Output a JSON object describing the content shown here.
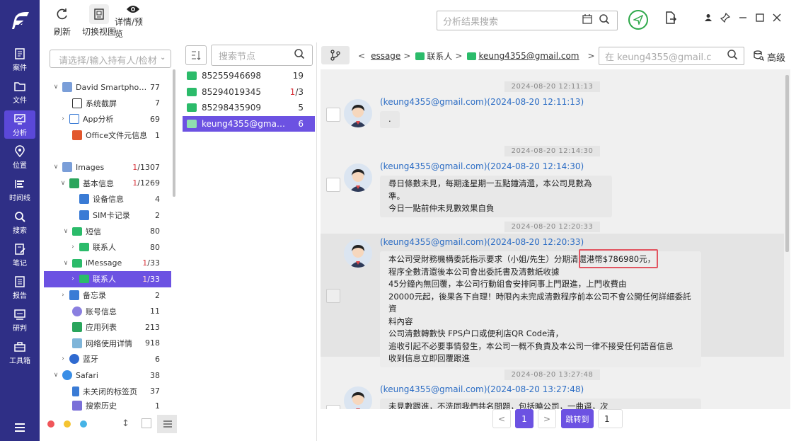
{
  "toolbar": {
    "refresh_label": "刷新",
    "switch_view_label": "切换视图",
    "detail_preview_label": "详情/预览",
    "search_placeholder": "分析结果搜索"
  },
  "nav": {
    "items": [
      {
        "label": "案件",
        "icon": "case-icon"
      },
      {
        "label": "文件",
        "icon": "folder-icon"
      },
      {
        "label": "分析",
        "icon": "analysis-icon",
        "active": true
      },
      {
        "label": "位置",
        "icon": "location-icon"
      },
      {
        "label": "时间线",
        "icon": "timeline-icon"
      },
      {
        "label": "搜索",
        "icon": "search-icon"
      },
      {
        "label": "笔记",
        "icon": "note-icon"
      },
      {
        "label": "报告",
        "icon": "report-icon"
      },
      {
        "label": "研判",
        "icon": "judge-icon"
      },
      {
        "label": "工具箱",
        "icon": "toolbox-icon"
      }
    ]
  },
  "tree": {
    "select_placeholder": "请选择/输入持有人/检材",
    "rows": [
      {
        "label": "David Smartphon...",
        "count": "77"
      },
      {
        "label": "系统截屏",
        "count": "7"
      },
      {
        "label": "App分析",
        "count": "69"
      },
      {
        "label": "Office文件元信息",
        "count": "1"
      },
      {
        "label": "Images",
        "count_red": "1",
        "count": "/1307"
      },
      {
        "label": "基本信息",
        "count_red": "1",
        "count": "/1269"
      },
      {
        "label": "设备信息",
        "count": "4"
      },
      {
        "label": "SIM卡记录",
        "count": "2"
      },
      {
        "label": "短信",
        "count": "80"
      },
      {
        "label": "联系人",
        "count": "80"
      },
      {
        "label": "iMessage",
        "count_red": "1",
        "count": "/33"
      },
      {
        "label": "联系人",
        "count_red": "1",
        "count": "/33"
      },
      {
        "label": "备忘录",
        "count": "2"
      },
      {
        "label": "账号信息",
        "count": "11"
      },
      {
        "label": "应用列表",
        "count": "213"
      },
      {
        "label": "网络使用详情",
        "count": "918"
      },
      {
        "label": "蓝牙",
        "count": "6"
      },
      {
        "label": "Safari",
        "count": "38"
      },
      {
        "label": "未关闭的标签页",
        "count": "37"
      },
      {
        "label": "搜索历史",
        "count": "1"
      }
    ]
  },
  "contacts": {
    "search_placeholder": "搜索节点",
    "items": [
      {
        "label": "85255946698",
        "count": "19"
      },
      {
        "label": "85294019345",
        "count_red": "1",
        "count": "/3"
      },
      {
        "label": "85298435909",
        "count": "5"
      },
      {
        "label": "keung4355@gmail.c...",
        "count": "6"
      }
    ]
  },
  "breadcrumb": {
    "part1": "essage",
    "part2": "联系人",
    "part3": "keung4355@gmail.com"
  },
  "msg_search_placeholder": "在 keung4355@gmail.c",
  "advanced_label": "高级",
  "messages": [
    {
      "time": "2024-08-20 12:11:13",
      "sender": "(keung4355@gmail.com)(2024-08-20 12:11:13)",
      "lines": [
        "."
      ]
    },
    {
      "time": "2024-08-20 12:14:30",
      "sender": "(keung4355@gmail.com)(2024-08-20 12:14:30)",
      "lines": [
        "尋日條數未見，每期逢星期一五點鐘清還，本公司見數為準。",
        "今日一點前仲未見數效果自負"
      ]
    },
    {
      "time": "2024-08-20 12:20:33",
      "sender": "(keung4355@gmail.com)(2024-08-20 12:20:33)",
      "lines": [
        "本公司受財務機構委託指示要求（小姐/先生）分期清還港幣$786980元，",
        "程序全數清還後本公司會出委託書及清數紙收據",
        "45分鐘內無回覆，本公司行動組會安排同事上門跟進，上門收費由",
        "20000元起，後果各下自理！時限內未完成清數程序前本公司不會公開任何詳細委託資",
        "料內容",
        "公司清數轉數快 FPS户口或便利店QR Code清，",
        "追收引起不必要事情發生，本公司一概不負責及本公司一律不接受任何語音信息",
        "收到信息立即回覆跟進"
      ]
    },
    {
      "time": "2024-08-20 13:27:48",
      "sender": "(keung4355@gmail.com)(2024-08-20 13:27:48)",
      "lines": [
        "未見數跟進，不洗同我們共名問題，包括曉公司，一曲逼，次"
      ]
    }
  ],
  "pager": {
    "prev": "<",
    "current": "1",
    "next": ">",
    "jump_label": "跳转到",
    "jump_value": "1"
  }
}
